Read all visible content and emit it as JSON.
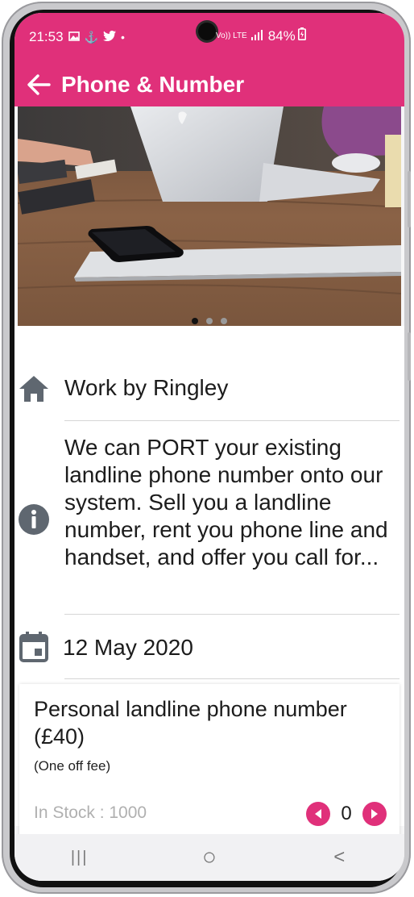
{
  "status_bar": {
    "time": "21:53",
    "left_icons": [
      "gallery-icon",
      "anchor-icon",
      "twitter-icon",
      "dot-icon"
    ],
    "volte": "Vo)) LTE",
    "battery": "84%"
  },
  "header": {
    "title": "Phone & Number",
    "back_icon": "arrow-left-icon"
  },
  "carousel": {
    "slides": 3,
    "active_index": 0
  },
  "info": {
    "company": "Work by Ringley",
    "description": "We can PORT your existing landline phone number onto our system. Sell you a landline number, rent you phone line and handset, and offer you call for...",
    "date": "12 May 2020"
  },
  "product": {
    "name": "Personal landline phone number (£40)",
    "fee_note": "(One off fee)",
    "stock": "In Stock : 1000",
    "quantity": "0"
  },
  "navbar": {
    "recent": "|||",
    "home": "○",
    "back": "<"
  },
  "colors": {
    "accent": "#e0307a",
    "icon_gray": "#5f6770"
  }
}
